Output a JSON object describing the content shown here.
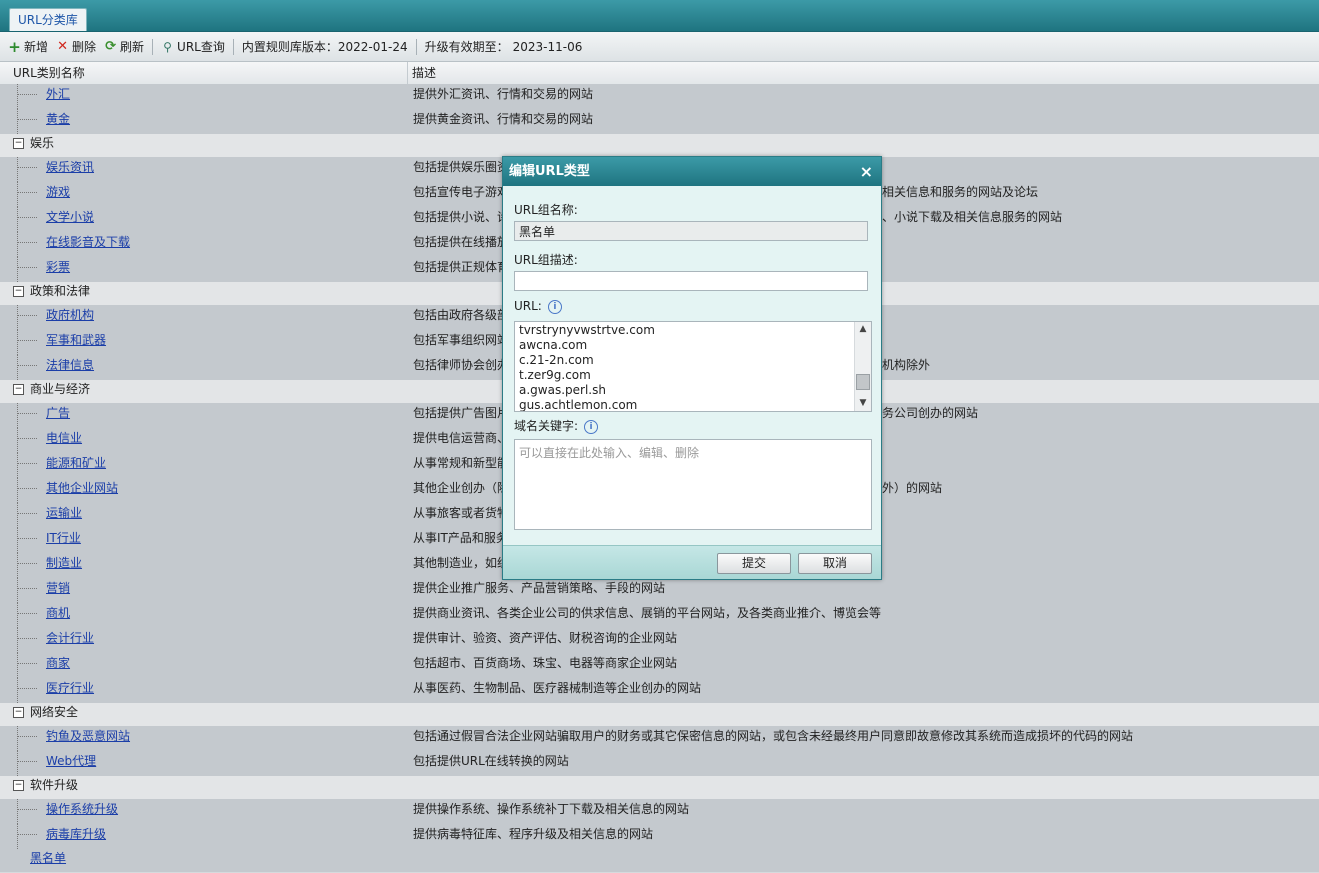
{
  "tab": {
    "label": "URL分类库"
  },
  "toolbar": {
    "add": "新增",
    "delete": "删除",
    "refresh": "刷新",
    "query": "URL查询",
    "version_label": "内置规则库版本：",
    "version_value": "2022-01-24",
    "expiry_label": "升级有效期至：",
    "expiry_value": "2023-11-06"
  },
  "columns": {
    "name": "URL类别名称",
    "desc": "描述"
  },
  "rows": [
    {
      "type": "item",
      "name": "外汇",
      "desc": "提供外汇资讯、行情和交易的网站"
    },
    {
      "type": "item",
      "name": "黄金",
      "desc": "提供黄金资讯、行情和交易的网站"
    },
    {
      "type": "cat",
      "name": "娱乐"
    },
    {
      "type": "item",
      "name": "娱乐资讯",
      "desc": "包括提供娱乐圈资"
    },
    {
      "type": "item",
      "name": "游戏",
      "desc": "包括宣传电子游戏",
      "desc2": "相关信息和服务的网站及论坛"
    },
    {
      "type": "item",
      "name": "文学小说",
      "desc": "包括提供小说、诗",
      "desc2": "、小说下载及相关信息服务的网站"
    },
    {
      "type": "item",
      "name": "在线影音及下载",
      "desc": "包括提供在线播放"
    },
    {
      "type": "item",
      "name": "彩票",
      "desc": "包括提供正规体育"
    },
    {
      "type": "cat",
      "name": "政策和法律"
    },
    {
      "type": "item",
      "name": "政府机构",
      "desc": "包括由政府各级部"
    },
    {
      "type": "item",
      "name": "军事和武器",
      "desc": "包括军事组织网站"
    },
    {
      "type": "item",
      "name": "法律信息",
      "desc": "包括律师协会创办",
      "desc2": "机构除外"
    },
    {
      "type": "cat",
      "name": "商业与经济"
    },
    {
      "type": "item",
      "name": "广告",
      "desc": "包括提供广告图片",
      "desc2": "务公司创办的网站"
    },
    {
      "type": "item",
      "name": "电信业",
      "desc": "提供电信运营商、"
    },
    {
      "type": "item",
      "name": "能源和矿业",
      "desc": "从事常规和新型能"
    },
    {
      "type": "item",
      "name": "其他企业网站",
      "desc": "其他企业创办（除",
      "desc2": "外）的网站"
    },
    {
      "type": "item",
      "name": "运输业",
      "desc": "从事旅客或者货物"
    },
    {
      "type": "item",
      "name": "IT行业",
      "desc": "从事IT产品和服务"
    },
    {
      "type": "item",
      "name": "制造业",
      "desc": "其他制造业，如纺"
    },
    {
      "type": "item",
      "name": "营销",
      "desc": "提供企业推广服务、产品营销策略、手段的网站"
    },
    {
      "type": "item",
      "name": "商机",
      "desc": "提供商业资讯、各类企业公司的供求信息、展销的平台网站，及各类商业推介、博览会等"
    },
    {
      "type": "item",
      "name": "会计行业",
      "desc": "提供审计、验资、资产评估、财税咨询的企业网站"
    },
    {
      "type": "item",
      "name": "商家",
      "desc": "包括超市、百货商场、珠宝、电器等商家企业网站"
    },
    {
      "type": "item",
      "name": "医疗行业",
      "desc": "从事医药、生物制品、医疗器械制造等企业创办的网站"
    },
    {
      "type": "cat",
      "name": "网络安全"
    },
    {
      "type": "item",
      "name": "钓鱼及恶意网站",
      "desc": "包括通过假冒合法企业网站骗取用户的财务或其它保密信息的网站，或包含未经最终用户同意即故意修改其系统而造成损坏的代码的网站"
    },
    {
      "type": "item",
      "name": "Web代理",
      "desc": "包括提供URL在线转换的网站"
    },
    {
      "type": "cat",
      "name": "软件升级"
    },
    {
      "type": "item",
      "name": "操作系统升级",
      "desc": "提供操作系统、操作系统补丁下载及相关信息的网站"
    },
    {
      "type": "item",
      "name": "病毒库升级",
      "desc": "提供病毒特征库、程序升级及相关信息的网站"
    },
    {
      "type": "root",
      "name": "黑名单"
    }
  ],
  "modal": {
    "title": "编辑URL类型",
    "close": "×",
    "group_name_label": "URL组名称:",
    "group_name_value": "黑名单",
    "group_desc_label": "URL组描述:",
    "group_desc_value": "",
    "url_label": "URL:",
    "urls": [
      "tvrstrynyvwstrtve.com",
      "awcna.com",
      "c.21-2n.com",
      "t.zer9g.com",
      "a.gwas.perl.sh",
      "gus.achtlemon.com"
    ],
    "keyword_label": "域名关键字:",
    "keyword_placeholder": "可以直接在此处输入、编辑、删除",
    "submit": "提交",
    "cancel": "取消"
  },
  "icons": {
    "add": "plus-icon",
    "delete": "x-icon",
    "refresh": "refresh-icon",
    "query": "search-icon",
    "info": "info-icon"
  },
  "colors": {
    "accent": "#1f7480",
    "link": "#1b3ea8",
    "add_icon": "#2e8b2e",
    "delete_icon": "#d0281e"
  }
}
